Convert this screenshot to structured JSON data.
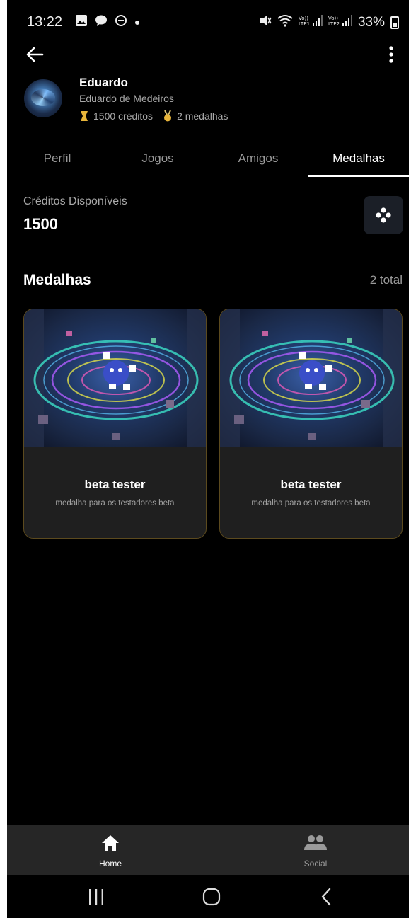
{
  "status_bar": {
    "time": "13:22",
    "battery": "33%",
    "icons": [
      "gallery-icon",
      "chat-icon",
      "dnd-icon",
      "dot-icon",
      "mute-icon",
      "wifi-icon",
      "signal-lte1-icon",
      "signal-lte2-icon",
      "battery-icon"
    ]
  },
  "profile": {
    "name": "Eduardo",
    "full_name": "Eduardo de Medeiros",
    "credits_text": "1500 créditos",
    "medals_text": "2 medalhas"
  },
  "tabs": [
    {
      "label": "Perfil",
      "active": false
    },
    {
      "label": "Jogos",
      "active": false
    },
    {
      "label": "Amigos",
      "active": false
    },
    {
      "label": "Medalhas",
      "active": true
    }
  ],
  "credits": {
    "label": "Créditos Disponíveis",
    "value": "1500"
  },
  "medals": {
    "title": "Medalhas",
    "count": "2 total",
    "items": [
      {
        "name": "beta tester",
        "description": "medalha para os testadores beta"
      },
      {
        "name": "beta tester",
        "description": "medalha para os testadores beta"
      }
    ]
  },
  "bottom_nav": [
    {
      "label": "Home",
      "icon": "home-icon",
      "active": true
    },
    {
      "label": "Social",
      "icon": "people-icon",
      "active": false
    }
  ],
  "colors": {
    "background": "#000000",
    "card_border": "#5c4a1e",
    "card_bg": "#1f1f1f",
    "nav_bg": "#262626"
  }
}
